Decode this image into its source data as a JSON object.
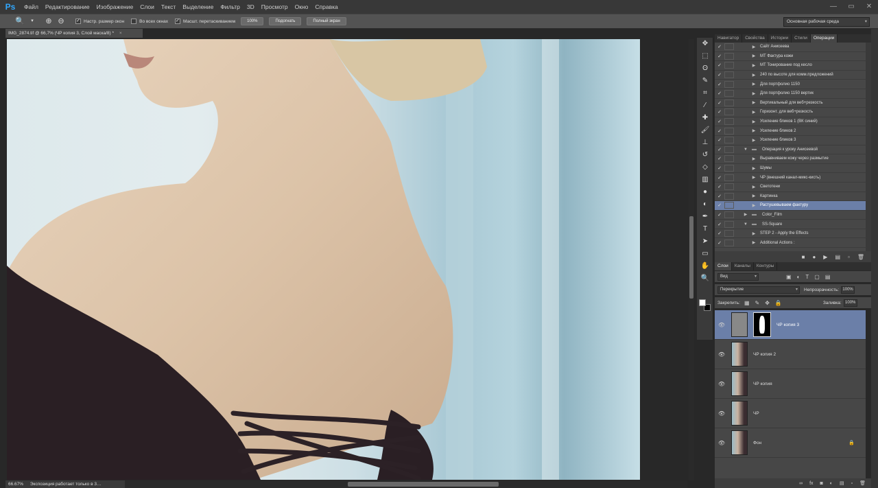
{
  "app": {
    "logo": "Ps"
  },
  "menu": [
    "Файл",
    "Редактирование",
    "Изображение",
    "Слои",
    "Текст",
    "Выделение",
    "Фильтр",
    "3D",
    "Просмотр",
    "Окно",
    "Справка"
  ],
  "window_controls": [
    "—",
    "▭",
    "✕"
  ],
  "options": {
    "checks": [
      {
        "label": "Настр. размер окон",
        "checked": true
      },
      {
        "label": "Во всех окнах",
        "checked": false
      },
      {
        "label": "Масшт. перетаскиванием",
        "checked": true
      }
    ],
    "zoom_value": "100%",
    "fit_label": "Подогнать",
    "fill_label": "Полный экран",
    "workspace": "Основная рабочая среда"
  },
  "document": {
    "tab": "IMG_2874.tif @ 66,7% (ЧР копия 3, Слой маска/8) *",
    "close": "×"
  },
  "status": {
    "zoom": "66.67%",
    "message": "Экспозиция работает только в 3…"
  },
  "panel_tabs": [
    "Навигатор",
    "Свойства",
    "Истории",
    "Стили",
    "Операции"
  ],
  "actions": [
    {
      "label": "Сайт Анисеева",
      "indent": 1,
      "folder": false,
      "sel": false
    },
    {
      "label": "МТ Фактура кожи",
      "indent": 1,
      "folder": false,
      "sel": false
    },
    {
      "label": "МТ Тонирование под кесло",
      "indent": 1,
      "folder": false,
      "sel": false
    },
    {
      "label": "240 по высоте для комм.предложений",
      "indent": 1,
      "folder": false,
      "sel": false
    },
    {
      "label": "Для портфолио 1150",
      "indent": 1,
      "folder": false,
      "sel": false
    },
    {
      "label": "Для портфолио 1150 вертик",
      "indent": 1,
      "folder": false,
      "sel": false
    },
    {
      "label": "Вертикальный для веб+резкость",
      "indent": 1,
      "folder": false,
      "sel": false
    },
    {
      "label": "Горизонт. для веб+резкость",
      "indent": 1,
      "folder": false,
      "sel": false
    },
    {
      "label": "Усиление бликов 1 (ВК синий)",
      "indent": 1,
      "folder": false,
      "sel": false
    },
    {
      "label": "Усиление бликов 2",
      "indent": 1,
      "folder": false,
      "sel": false
    },
    {
      "label": "Усиление бликов 3",
      "indent": 1,
      "folder": false,
      "sel": false
    },
    {
      "label": "Операция к уроку Анисеевой",
      "indent": 0,
      "folder": true,
      "open": true,
      "sel": false
    },
    {
      "label": "Выравниваем кожу через размытие",
      "indent": 1,
      "folder": false,
      "sel": false
    },
    {
      "label": "Шумы",
      "indent": 1,
      "folder": false,
      "sel": false
    },
    {
      "label": "ЧР (внешний канал-микс-кисть)",
      "indent": 1,
      "folder": false,
      "sel": false
    },
    {
      "label": "Светотени",
      "indent": 1,
      "folder": false,
      "sel": false
    },
    {
      "label": "Картинка",
      "indent": 1,
      "folder": false,
      "sel": false
    },
    {
      "label": "Растушевываем фактуру",
      "indent": 1,
      "folder": false,
      "sel": true
    },
    {
      "label": "Color_Film",
      "indent": 0,
      "folder": true,
      "open": false,
      "sel": false
    },
    {
      "label": "SS-Square",
      "indent": 0,
      "folder": true,
      "open": true,
      "sel": false
    },
    {
      "label": "STEP 2 - Apply the Effects",
      "indent": 1,
      "folder": false,
      "sel": false
    },
    {
      "label": "Additional Actions :",
      "indent": 1,
      "folder": false,
      "sel": false
    }
  ],
  "layers_tabs": [
    "Слои",
    "Каналы",
    "Контуры"
  ],
  "layers_filter": "Вид",
  "blend_mode": "Перекрытие",
  "opacity_label": "Непрозрачность:",
  "opacity_value": "100%",
  "lock_label": "Закрепить:",
  "fill_label": "Заливка:",
  "fill_value": "100%",
  "layers": [
    {
      "name": "ЧР копия 3",
      "selected": true,
      "mask": true,
      "locked": false,
      "gray": true
    },
    {
      "name": "ЧР копия 2",
      "selected": false,
      "mask": false,
      "locked": false,
      "gray": false
    },
    {
      "name": "ЧР копия",
      "selected": false,
      "mask": false,
      "locked": false,
      "gray": false
    },
    {
      "name": "ЧР",
      "selected": false,
      "mask": false,
      "locked": false,
      "gray": false
    },
    {
      "name": "Фон",
      "selected": false,
      "mask": false,
      "locked": true,
      "gray": false
    }
  ],
  "icons": {
    "tools": [
      "move-icon",
      "marquee-icon",
      "lasso-icon",
      "quick-select-icon",
      "crop-icon",
      "eyedropper-icon",
      "healing-icon",
      "brush-icon",
      "stamp-icon",
      "history-brush-icon",
      "eraser-icon",
      "gradient-icon",
      "blur-icon",
      "dodge-icon",
      "pen-icon",
      "type-icon",
      "path-select-icon",
      "shape-icon",
      "hand-icon",
      "zoom-icon"
    ]
  },
  "colors": {
    "selection": "#6b7fa8",
    "panel": "#474747",
    "menubar": "#383838"
  }
}
